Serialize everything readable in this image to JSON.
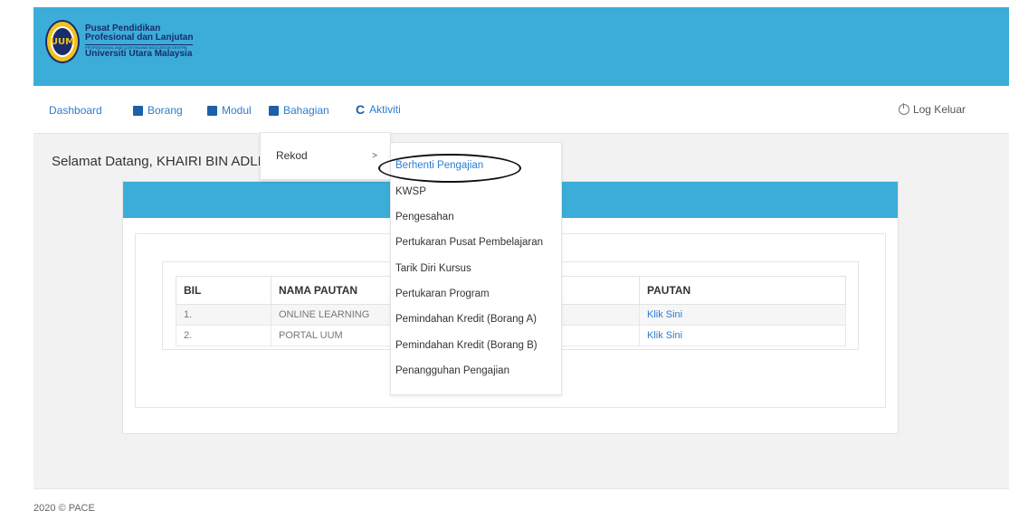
{
  "brand": {
    "seal_text": "UUM",
    "line1": "Pusat Pendidikan",
    "line2": "Profesional dan Lanjutan",
    "line3": "PROFESSIONAL AND CONTINUING EDUCATION CENTRE",
    "line4": "Universiti Utara Malaysia"
  },
  "nav": {
    "items": [
      {
        "label": "Dashboard",
        "icon": "dashboard-icon"
      },
      {
        "label": "Borang",
        "icon": "form-icon"
      },
      {
        "label": "Modul",
        "icon": "book-icon"
      },
      {
        "label": "Bahagian",
        "icon": "book-icon"
      },
      {
        "label": "Aktiviti",
        "icon": "refresh-icon"
      }
    ],
    "logout": "Log Keluar"
  },
  "welcome": "Selamat Datang, KHAIRI BIN ADLI",
  "table": {
    "headers": [
      "BIL",
      "NAMA PAUTAN",
      "PAUTAN"
    ],
    "rows": [
      {
        "bil": "1.",
        "nama": "ONLINE LEARNING",
        "pautan": "Klik Sini"
      },
      {
        "bil": "2.",
        "nama": "PORTAL UUM",
        "pautan": "Klik Sini"
      }
    ]
  },
  "menu": {
    "level1": {
      "label": "Rekod",
      "arrow": ">"
    },
    "level2": [
      "Berhenti Pengajian",
      "KWSP",
      "Pengesahan",
      "Pertukaran Pusat Pembelajaran",
      "Tarik Diri Kursus",
      "Pertukaran Program",
      "Pemindahan Kredit (Borang A)",
      "Pemindahan Kredit (Borang B)",
      "Penangguhan Pengajian"
    ]
  },
  "footer": "2020 © PACE",
  "colors": {
    "banner": "#3badd8",
    "link": "#2a7ed1",
    "icon": "#1d5fa8"
  }
}
